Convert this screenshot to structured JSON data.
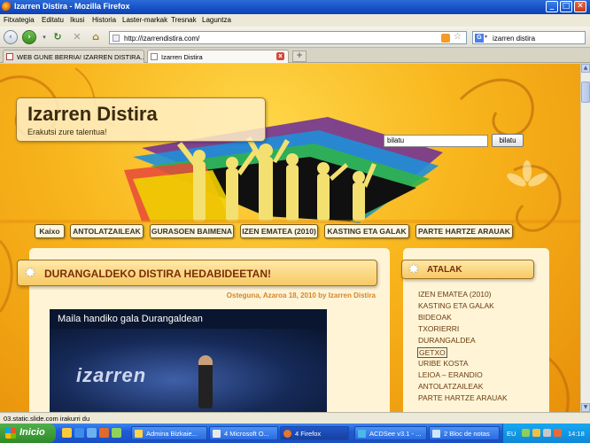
{
  "window": {
    "title": "Izarren Distira - Mozilla Firefox"
  },
  "menu": [
    "Fitxategia",
    "Editatu",
    "Ikusi",
    "Historia",
    "Laster-markak",
    "Tresnak",
    "Laguntza"
  ],
  "nav": {
    "url": "http://izarrendistira.com/",
    "search_engine": "Google",
    "search_value": "izarren distira"
  },
  "tabs": [
    {
      "label": "WEB GUNE BERRIA! IZARREN DISTIRA...",
      "active": false
    },
    {
      "label": "Izarren Distira",
      "active": true
    }
  ],
  "site": {
    "name": "Izarren Distira",
    "tagline": "Erakutsi zure talentua!",
    "search_value": "bilatu",
    "search_button": "bilatu",
    "nav_items": [
      "Kaixo",
      "ANTOLATZAILEAK",
      "GURASOEN BAIMENA",
      "IZEN EMATEA (2010)",
      "KASTING ETA GALAK",
      "PARTE HARTZE ARAUAK"
    ]
  },
  "post": {
    "title": "DURANGALDEKO DISTIRA HEDABIDEETAN!",
    "meta": "Osteguna, Azaroa 18, 2010 by Izarren Distira",
    "video_title": "Maila handiko gala Durangaldean"
  },
  "sidebar": {
    "title": "ATALAK",
    "items": [
      "IZEN EMATEA (2010)",
      "KASTING ETA GALAK",
      "BIDEOAK",
      "TXORIERRI",
      "DURANGALDEA",
      "GETXO",
      "URIBE KOSTA",
      "LEIOA – ERANDIO",
      "ANTOLATZAILEAK",
      "PARTE HARTZE ARAUAK"
    ],
    "selected": "GETXO"
  },
  "status": {
    "text": "03.static.slide.com irakurri du"
  },
  "taskbar": {
    "start": "Inicio",
    "tasks": [
      {
        "label": "Admina Bizkaie..."
      },
      {
        "label": "4 Microsoft O..."
      },
      {
        "label": "4 Firefox",
        "active": true
      },
      {
        "label": "ACDSee v3.1 - ..."
      },
      {
        "label": "2 Bloc de notas"
      }
    ],
    "lang": "EU",
    "clock": "14:18"
  },
  "colors": {
    "accent": "#f7c963",
    "title_text": "#7a2e0a",
    "link": "#6a3b12",
    "meta": "#d4862c"
  }
}
